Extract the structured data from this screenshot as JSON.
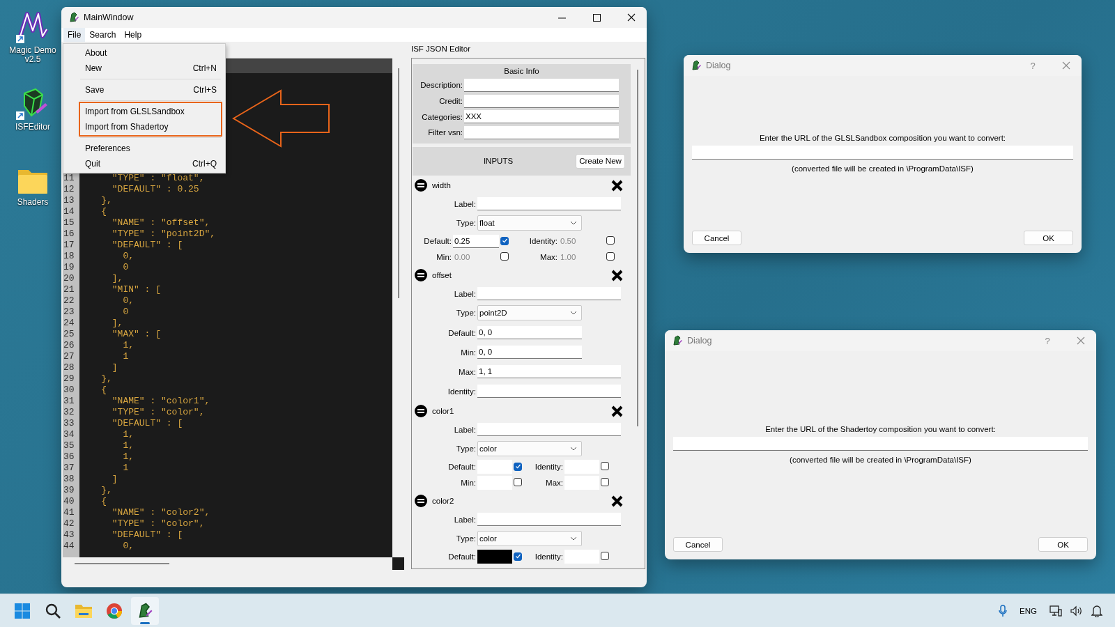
{
  "desktop_icons": [
    {
      "kind": "magic",
      "label": "Magic Demo v2.5"
    },
    {
      "kind": "isf",
      "label": "ISFEditor"
    },
    {
      "kind": "folder",
      "label": "Shaders"
    }
  ],
  "main_window": {
    "title": "MainWindow",
    "menubar": [
      {
        "label": "File",
        "selected": true
      },
      {
        "label": "Search",
        "selected": false
      },
      {
        "label": "Help",
        "selected": false
      }
    ],
    "file_menu": {
      "groups": [
        {
          "highlighted": false,
          "items": [
            {
              "label": "About"
            },
            {
              "label": "New",
              "shortcut": "Ctrl+N"
            }
          ]
        },
        {
          "highlighted": false,
          "items": [
            {
              "label": "Save",
              "shortcut": "Ctrl+S"
            }
          ]
        },
        {
          "highlighted": true,
          "items": [
            {
              "label": "Import from GLSLSandbox"
            },
            {
              "label": "Import from Shadertoy"
            }
          ]
        },
        {
          "highlighted": false,
          "items": [
            {
              "label": "Preferences"
            },
            {
              "label": "Quit",
              "shortcut": "Ctrl+Q"
            }
          ]
        }
      ]
    },
    "code_lines": [
      {
        "number": "11",
        "text": "      \"TYPE\" : \"float\","
      },
      {
        "number": "12",
        "text": "      \"DEFAULT\" : 0.25"
      },
      {
        "number": "13",
        "text": "    },"
      },
      {
        "number": "14",
        "text": "    {"
      },
      {
        "number": "15",
        "text": "      \"NAME\" : \"offset\","
      },
      {
        "number": "16",
        "text": "      \"TYPE\" : \"point2D\","
      },
      {
        "number": "17",
        "text": "      \"DEFAULT\" : ["
      },
      {
        "number": "18",
        "text": "        0,"
      },
      {
        "number": "19",
        "text": "        0"
      },
      {
        "number": "20",
        "text": "      ],"
      },
      {
        "number": "21",
        "text": "      \"MIN\" : ["
      },
      {
        "number": "22",
        "text": "        0,"
      },
      {
        "number": "23",
        "text": "        0"
      },
      {
        "number": "24",
        "text": "      ],"
      },
      {
        "number": "25",
        "text": "      \"MAX\" : ["
      },
      {
        "number": "26",
        "text": "        1,"
      },
      {
        "number": "27",
        "text": "        1"
      },
      {
        "number": "28",
        "text": "      ]"
      },
      {
        "number": "29",
        "text": "    },"
      },
      {
        "number": "30",
        "text": "    {"
      },
      {
        "number": "31",
        "text": "      \"NAME\" : \"color1\","
      },
      {
        "number": "32",
        "text": "      \"TYPE\" : \"color\","
      },
      {
        "number": "33",
        "text": "      \"DEFAULT\" : ["
      },
      {
        "number": "34",
        "text": "        1,"
      },
      {
        "number": "35",
        "text": "        1,"
      },
      {
        "number": "36",
        "text": "        1,"
      },
      {
        "number": "37",
        "text": "        1"
      },
      {
        "number": "38",
        "text": "      ]"
      },
      {
        "number": "39",
        "text": "    },"
      },
      {
        "number": "40",
        "text": "    {"
      },
      {
        "number": "41",
        "text": "      \"NAME\" : \"color2\","
      },
      {
        "number": "42",
        "text": "      \"TYPE\" : \"color\","
      },
      {
        "number": "43",
        "text": "      \"DEFAULT\" : ["
      },
      {
        "number": "44",
        "text": "        0,"
      }
    ],
    "json_editor": {
      "title": "ISF JSON Editor",
      "basic_info": {
        "heading": "Basic Info",
        "fields": [
          {
            "label": "Description:"
          },
          {
            "label": "Credit:"
          },
          {
            "label": "Categories:",
            "value": "XXX"
          },
          {
            "label": "Filter vsn:"
          }
        ]
      },
      "inputs_heading": "INPUTS",
      "create_button": "Create New",
      "inputs": [
        {
          "kind": "float",
          "name": "width",
          "label_caption": "Label:",
          "type_caption": "Type:",
          "type_value": "float",
          "params": [
            {
              "caption": "Default:",
              "value": "0.25",
              "checked": true
            },
            {
              "caption": "Identity:",
              "value": "0.50",
              "checked": false
            },
            {
              "caption": "Min:",
              "value": "0.00",
              "checked": false
            },
            {
              "caption": "Max:",
              "value": "1.00",
              "checked": false
            }
          ]
        },
        {
          "kind": "point2D",
          "name": "offset",
          "label_caption": "Label:",
          "type_caption": "Type:",
          "type_value": "point2D",
          "params": [
            {
              "caption": "Default:",
              "value": "0, 0"
            },
            {
              "caption": "Min:",
              "value": "0, 0"
            },
            {
              "caption": "Max:",
              "value": "1, 1"
            },
            {
              "caption": "Identity:"
            }
          ]
        },
        {
          "kind": "color",
          "name": "color1",
          "label_caption": "Label:",
          "type_caption": "Type:",
          "type_value": "color",
          "params": [
            {
              "caption": "Default:",
              "color": "#ffffff",
              "checked": true
            },
            {
              "caption": "Identity:",
              "color": "#ffffff",
              "checked": false
            },
            {
              "caption": "Min:",
              "color": "#ffffff",
              "checked": false
            },
            {
              "caption": "Max:",
              "color": "#ffffff",
              "checked": false
            }
          ]
        },
        {
          "kind": "color",
          "name": "color2",
          "label_caption": "Label:",
          "type_caption": "Type:",
          "type_value": "color",
          "params": [
            {
              "caption": "Default:",
              "color": "#000000",
              "checked": true
            },
            {
              "caption": "Identity:",
              "color": "#ffffff",
              "checked": false
            }
          ]
        }
      ]
    }
  },
  "dialogs": [
    {
      "title": "Dialog",
      "help": "?",
      "prompt": "Enter the URL of the GLSLSandbox composition you want to convert:",
      "note": "(converted file will be created in \\ProgramData\\ISF)",
      "buttons": [
        "Cancel",
        "OK"
      ]
    },
    {
      "title": "Dialog",
      "help": "?",
      "prompt": "Enter the URL of the Shadertoy composition you want to convert:",
      "note": "(converted file will be created in \\ProgramData\\ISF)",
      "buttons": [
        "Cancel",
        "OK"
      ]
    }
  ],
  "taskbar": {
    "apps": [
      {
        "kind": "start",
        "active": false
      },
      {
        "kind": "search",
        "active": false
      },
      {
        "kind": "folder",
        "active": false
      },
      {
        "kind": "browser",
        "active": false
      },
      {
        "kind": "app",
        "active": true
      }
    ],
    "language": "ENG"
  }
}
